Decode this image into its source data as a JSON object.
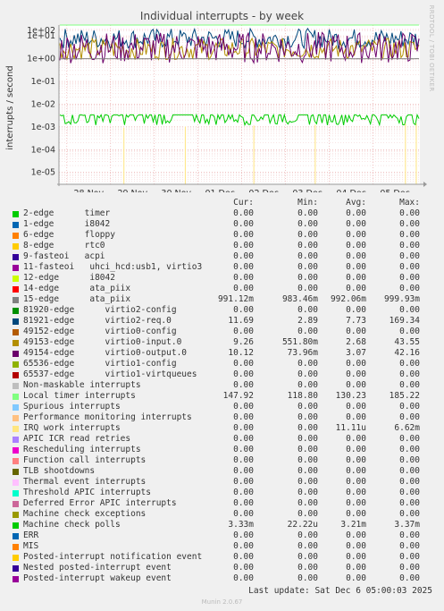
{
  "chart_data": {
    "type": "line",
    "title": "Individual interrupts - by week",
    "ylabel": "interrupts / second",
    "yscale": "log",
    "ylim": [
      3e-06,
      30
    ],
    "yticks": [
      {
        "value": 100,
        "label": "1e+02"
      },
      {
        "value": 10,
        "label": "1e+01"
      },
      {
        "value": 1,
        "label": "1e+00"
      },
      {
        "value": 0.1,
        "label": "1e-01"
      },
      {
        "value": 0.01,
        "label": "1e-02"
      },
      {
        "value": 0.001,
        "label": "1e-03"
      },
      {
        "value": 0.0001,
        "label": "1e-04"
      },
      {
        "value": 1e-05,
        "label": "1e-05"
      }
    ],
    "xticks": [
      "28 Nov",
      "29 Nov",
      "30 Nov",
      "01 Dec",
      "02 Dec",
      "03 Dec",
      "04 Dec",
      "05 Dec"
    ],
    "grid": true,
    "columns": [
      "Cur:",
      "Min:",
      "Avg:",
      "Max:"
    ],
    "series": [
      {
        "name": "2-edge      timer",
        "color": "#00cc00",
        "values": [
          "0.00",
          "0.00",
          "0.00",
          "0.00"
        ]
      },
      {
        "name": "1-edge      i8042",
        "color": "#0066b3",
        "values": [
          "0.00",
          "0.00",
          "0.00",
          "0.00"
        ]
      },
      {
        "name": "6-edge      floppy",
        "color": "#ff8000",
        "values": [
          "0.00",
          "0.00",
          "0.00",
          "0.00"
        ]
      },
      {
        "name": "8-edge      rtc0",
        "color": "#ffcc00",
        "values": [
          "0.00",
          "0.00",
          "0.00",
          "0.00"
        ]
      },
      {
        "name": "9-fasteoi   acpi",
        "color": "#330099",
        "values": [
          "0.00",
          "0.00",
          "0.00",
          "0.00"
        ]
      },
      {
        "name": "11-fasteoi   uhci_hcd:usb1, virtio3",
        "color": "#990099",
        "values": [
          "0.00",
          "0.00",
          "0.00",
          "0.00"
        ]
      },
      {
        "name": "12-edge      i8042",
        "color": "#ccff00",
        "values": [
          "0.00",
          "0.00",
          "0.00",
          "0.00"
        ]
      },
      {
        "name": "14-edge      ata_piix",
        "color": "#ff0000",
        "values": [
          "0.00",
          "0.00",
          "0.00",
          "0.00"
        ]
      },
      {
        "name": "15-edge      ata_piix",
        "color": "#808080",
        "values": [
          "991.12m",
          "983.46m",
          "992.06m",
          "999.93m"
        ]
      },
      {
        "name": "81920-edge      virtio2-config",
        "color": "#008f00",
        "values": [
          "0.00",
          "0.00",
          "0.00",
          "0.00"
        ]
      },
      {
        "name": "81921-edge      virtio2-req.0",
        "color": "#00487d",
        "values": [
          "11.69",
          "2.89",
          "7.73",
          "169.34"
        ]
      },
      {
        "name": "49152-edge      virtio0-config",
        "color": "#b35a00",
        "values": [
          "0.00",
          "0.00",
          "0.00",
          "0.00"
        ]
      },
      {
        "name": "49153-edge      virtio0-input.0",
        "color": "#b38f00",
        "values": [
          "9.26",
          "551.80m",
          "2.68",
          "43.55"
        ]
      },
      {
        "name": "49154-edge      virtio0-output.0",
        "color": "#6b006b",
        "values": [
          "10.12",
          "73.96m",
          "3.07",
          "42.16"
        ]
      },
      {
        "name": "65536-edge      virtio1-config",
        "color": "#8fb300",
        "values": [
          "0.00",
          "0.00",
          "0.00",
          "0.00"
        ]
      },
      {
        "name": "65537-edge      virtio1-virtqueues",
        "color": "#b30000",
        "values": [
          "0.00",
          "0.00",
          "0.00",
          "0.00"
        ]
      },
      {
        "name": "Non-maskable interrupts",
        "color": "#bebebe",
        "values": [
          "0.00",
          "0.00",
          "0.00",
          "0.00"
        ]
      },
      {
        "name": "Local timer interrupts",
        "color": "#80ff80",
        "values": [
          "147.92",
          "118.80",
          "130.23",
          "185.22"
        ]
      },
      {
        "name": "Spurious interrupts",
        "color": "#80c9ff",
        "values": [
          "0.00",
          "0.00",
          "0.00",
          "0.00"
        ]
      },
      {
        "name": "Performance monitoring interrupts",
        "color": "#ffc080",
        "values": [
          "0.00",
          "0.00",
          "0.00",
          "0.00"
        ]
      },
      {
        "name": "IRQ work interrupts",
        "color": "#ffe680",
        "values": [
          "0.00",
          "0.00",
          "11.11u",
          "6.62m"
        ]
      },
      {
        "name": "APIC ICR read retries",
        "color": "#aa80ff",
        "values": [
          "0.00",
          "0.00",
          "0.00",
          "0.00"
        ]
      },
      {
        "name": "Rescheduling interrupts",
        "color": "#ee00cc",
        "values": [
          "0.00",
          "0.00",
          "0.00",
          "0.00"
        ]
      },
      {
        "name": "Function call interrupts",
        "color": "#ff8080",
        "values": [
          "0.00",
          "0.00",
          "0.00",
          "0.00"
        ]
      },
      {
        "name": "TLB shootdowns",
        "color": "#666600",
        "values": [
          "0.00",
          "0.00",
          "0.00",
          "0.00"
        ]
      },
      {
        "name": "Thermal event interrupts",
        "color": "#ffbfff",
        "values": [
          "0.00",
          "0.00",
          "0.00",
          "0.00"
        ]
      },
      {
        "name": "Threshold APIC interrupts",
        "color": "#00ffcc",
        "values": [
          "0.00",
          "0.00",
          "0.00",
          "0.00"
        ]
      },
      {
        "name": "Deferred Error APIC interrupts",
        "color": "#cc6699",
        "values": [
          "0.00",
          "0.00",
          "0.00",
          "0.00"
        ]
      },
      {
        "name": "Machine check exceptions",
        "color": "#999900",
        "values": [
          "0.00",
          "0.00",
          "0.00",
          "0.00"
        ]
      },
      {
        "name": "Machine check polls",
        "color": "#00cc00",
        "values": [
          "3.33m",
          "22.22u",
          "3.21m",
          "3.37m"
        ]
      },
      {
        "name": "ERR",
        "color": "#0066b3",
        "values": [
          "0.00",
          "0.00",
          "0.00",
          "0.00"
        ]
      },
      {
        "name": "MIS",
        "color": "#ff8000",
        "values": [
          "0.00",
          "0.00",
          "0.00",
          "0.00"
        ]
      },
      {
        "name": "Posted-interrupt notification event",
        "color": "#ffcc00",
        "values": [
          "0.00",
          "0.00",
          "0.00",
          "0.00"
        ]
      },
      {
        "name": "Nested posted-interrupt event",
        "color": "#330099",
        "values": [
          "0.00",
          "0.00",
          "0.00",
          "0.00"
        ]
      },
      {
        "name": "Posted-interrupt wakeup event",
        "color": "#990099",
        "values": [
          "0.00",
          "0.00",
          "0.00",
          "0.00"
        ]
      }
    ]
  },
  "watermark": "RRDTOOL / TOBI OETIKER",
  "footer": {
    "last_update": "Last update: Sat Dec  6 05:00:03 2025",
    "version": "Munin 2.0.67"
  }
}
